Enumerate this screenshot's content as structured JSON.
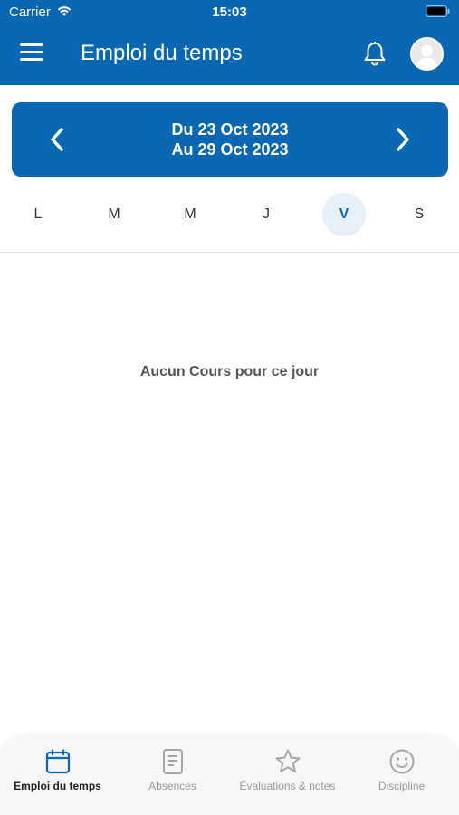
{
  "status_bar": {
    "carrier": "Carrier",
    "time": "15:03"
  },
  "header": {
    "title": "Emploi du temps"
  },
  "week": {
    "line1": "Du 23 Oct 2023",
    "line2": "Au 29 Oct 2023"
  },
  "days": [
    {
      "label": "L",
      "active": false
    },
    {
      "label": "M",
      "active": false
    },
    {
      "label": "M",
      "active": false
    },
    {
      "label": "J",
      "active": false
    },
    {
      "label": "V",
      "active": true
    },
    {
      "label": "S",
      "active": false
    }
  ],
  "empty_message": "Aucun Cours pour ce jour",
  "tabs": [
    {
      "label": "Emploi du temps",
      "icon": "calendar-icon",
      "active": true
    },
    {
      "label": "Absences",
      "icon": "document-icon",
      "active": false
    },
    {
      "label": "Évaluations & notes",
      "icon": "star-icon",
      "active": false
    },
    {
      "label": "Discipline",
      "icon": "smiley-icon",
      "active": false
    }
  ],
  "colors": {
    "primary": "#0a67b3",
    "active_day_bg": "#e7f0f8",
    "tab_active": "#0a67b3",
    "tab_inactive": "#999999"
  }
}
